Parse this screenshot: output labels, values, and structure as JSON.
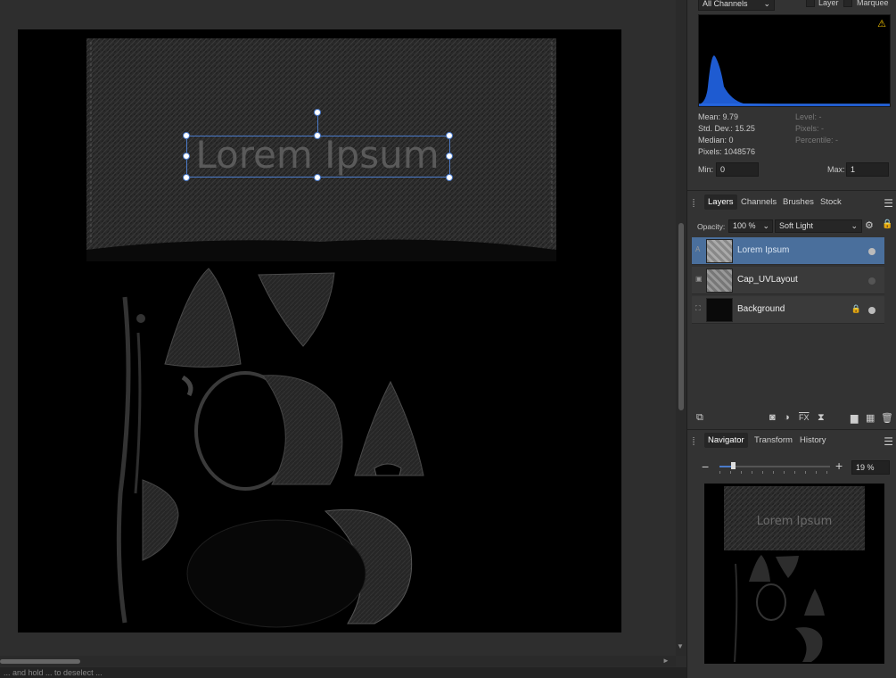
{
  "histogram": {
    "channel_select": "All Channels",
    "layer_label": "Layer",
    "marquee_label": "Marquee",
    "warning_icon": "warning-triangle-icon",
    "stats_left": [
      "Mean: 9.79",
      "Std. Dev.: 15.25",
      "Median: 0",
      "Pixels: 1048576"
    ],
    "stats_right": [
      "Level: -",
      "Pixels: -",
      "Percentile: -"
    ],
    "min_label": "Min:",
    "min_value": "0",
    "max_label": "Max:",
    "max_value": "1",
    "fill_color": "#1e5bd1"
  },
  "layers_panel": {
    "tabs": [
      "Layers",
      "Channels",
      "Brushes",
      "Stock"
    ],
    "active_tab": "Layers",
    "opacity_label": "Opacity:",
    "opacity_value": "100 %",
    "blend_mode": "Soft Light",
    "layers": [
      {
        "name": "Lorem Ipsum",
        "type": "A",
        "selected": true,
        "visible": true,
        "locked": false
      },
      {
        "name": "Cap_UVLayout",
        "type": "▣",
        "selected": false,
        "visible": false,
        "locked": false
      },
      {
        "name": "Background",
        "type": "⛶",
        "selected": false,
        "visible": true,
        "locked": true
      }
    ],
    "toolbar_icons": [
      "layer-copy-icon",
      "mask-icon",
      "adjustment-icon",
      "fx-icon",
      "hourglass-icon",
      "folder-icon",
      "pixel-layer-icon",
      "trash-icon"
    ],
    "selection_color": "#4a6f9c"
  },
  "navigator_panel": {
    "tabs": [
      "Navigator",
      "Transform",
      "History"
    ],
    "active_tab": "Navigator",
    "zoom_value": "19 %",
    "zoom_level": 0.12,
    "preview_text": "Lorem Ipsum"
  },
  "canvas": {
    "text_layer": "Lorem Ipsum",
    "selection_color": "#4a7ac9"
  },
  "status_bar": {
    "text": "... and hold ... to deselect ..."
  }
}
